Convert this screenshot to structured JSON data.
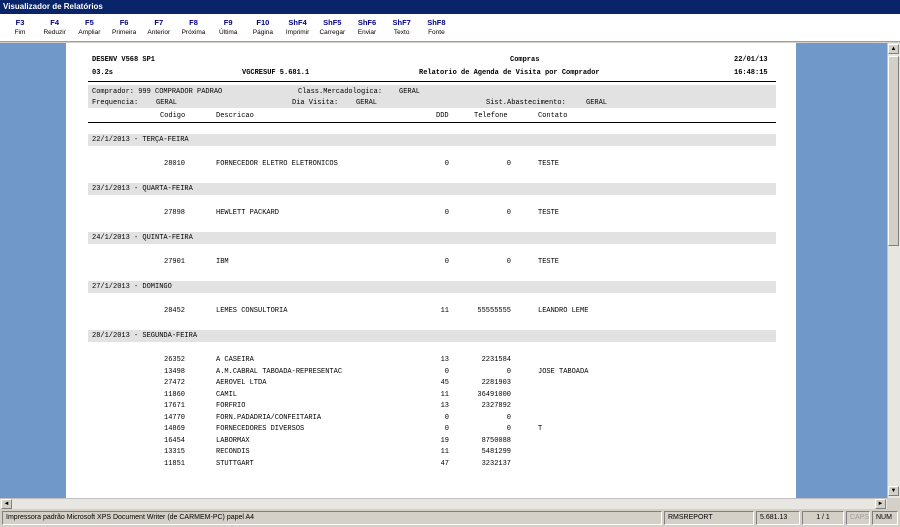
{
  "window": {
    "title": "Visualizador de Relatórios"
  },
  "toolbar": [
    {
      "key": "F3",
      "label": "Fim"
    },
    {
      "key": "F4",
      "label": "Reduzir"
    },
    {
      "key": "F5",
      "label": "Ampliar"
    },
    {
      "key": "F6",
      "label": "Primeira"
    },
    {
      "key": "F7",
      "label": "Anterior"
    },
    {
      "key": "F8",
      "label": "Próxima"
    },
    {
      "key": "F9",
      "label": "Última"
    },
    {
      "key": "F10",
      "label": "Página"
    },
    {
      "key": "ShF4",
      "label": "Imprimir"
    },
    {
      "key": "ShF5",
      "label": "Carregar"
    },
    {
      "key": "ShF6",
      "label": "Enviar"
    },
    {
      "key": "ShF7",
      "label": "Texto"
    },
    {
      "key": "ShF8",
      "label": "Fonte"
    }
  ],
  "report": {
    "header": {
      "env": "DESENV V568 SP1",
      "version": "03.2s",
      "program": "VGCRESUF 5.681.1",
      "module": "Compras",
      "title": "Relatorio de Agenda de Visita por Comprador",
      "date": "22/01/13",
      "time": "16:48:15"
    },
    "filters": {
      "comprador": "Comprador: 999 COMPRADOR PADRAO",
      "class_label": "Class.Mercadologica:",
      "class_value": "GERAL",
      "freq_label": "Frequencia:",
      "freq_value": "GERAL",
      "dia_label": "Dia Visita:",
      "dia_value": "GERAL",
      "sist_label": "Sist.Abastecimento:",
      "sist_value": "GERAL"
    },
    "columns": {
      "codigo": "Codigo",
      "descricao": "Descricao",
      "ddd": "DDD",
      "telefone": "Telefone",
      "contato": "Contato"
    },
    "groups": [
      {
        "day": "22/1/2013 - TERÇA-FEIRA",
        "rows": [
          {
            "codigo": "28010",
            "descricao": "FORNECEDOR ELETRO ELETRONICOS",
            "ddd": "0",
            "telefone": "0",
            "contato": "TESTE"
          }
        ]
      },
      {
        "day": "23/1/2013 - QUARTA-FEIRA",
        "rows": [
          {
            "codigo": "27898",
            "descricao": "HEWLETT PACKARD",
            "ddd": "0",
            "telefone": "0",
            "contato": "TESTE"
          }
        ]
      },
      {
        "day": "24/1/2013 - QUINTA-FEIRA",
        "rows": [
          {
            "codigo": "27901",
            "descricao": "IBM",
            "ddd": "0",
            "telefone": "0",
            "contato": "TESTE"
          }
        ]
      },
      {
        "day": "27/1/2013 - DOMINGO",
        "rows": [
          {
            "codigo": "28452",
            "descricao": "LEMES CONSULTORIA",
            "ddd": "11",
            "telefone": "55555555",
            "contato": "LEANDRO LEME"
          }
        ]
      },
      {
        "day": "28/1/2013 - SEGUNDA-FEIRA",
        "rows": [
          {
            "codigo": "26352",
            "descricao": "A CASEIRA",
            "ddd": "13",
            "telefone": "2231584",
            "contato": ""
          },
          {
            "codigo": "13498",
            "descricao": "A.M.CABRAL TABOADA-REPRESENTAC",
            "ddd": "0",
            "telefone": "0",
            "contato": "JOSE TABOADA"
          },
          {
            "codigo": "27472",
            "descricao": "AEROVEL LTDA",
            "ddd": "45",
            "telefone": "2281903",
            "contato": ""
          },
          {
            "codigo": "11860",
            "descricao": "CAMIL",
            "ddd": "11",
            "telefone": "36491000",
            "contato": ""
          },
          {
            "codigo": "17671",
            "descricao": "FORFRIO",
            "ddd": "13",
            "telefone": "2327892",
            "contato": ""
          },
          {
            "codigo": "14770",
            "descricao": "FORN.PADADRIA/CONFEITARIA",
            "ddd": "0",
            "telefone": "0",
            "contato": ""
          },
          {
            "codigo": "14869",
            "descricao": "FORNECEDORES DIVERSOS",
            "ddd": "0",
            "telefone": "0",
            "contato": "T"
          },
          {
            "codigo": "16454",
            "descricao": "LABORMAX",
            "ddd": "19",
            "telefone": "8750088",
            "contato": ""
          },
          {
            "codigo": "13315",
            "descricao": "RECONDIS",
            "ddd": "11",
            "telefone": "5481299",
            "contato": ""
          },
          {
            "codigo": "11851",
            "descricao": "STUTTGART",
            "ddd": "47",
            "telefone": "3232137",
            "contato": ""
          }
        ]
      }
    ]
  },
  "status": {
    "printer": "Impressora padrão Microsoft XPS Document Writer (de CARMEM-PC) papel A4",
    "report": "RMSREPORT",
    "version": "5.681.13",
    "pages": "1 / 1",
    "caps": "CAPS",
    "num": "NUM"
  },
  "colors": {
    "titlebar": "#0a246a",
    "page_background": "#7098c8",
    "band": "#e2e2e2",
    "key_text": "#00008b"
  }
}
